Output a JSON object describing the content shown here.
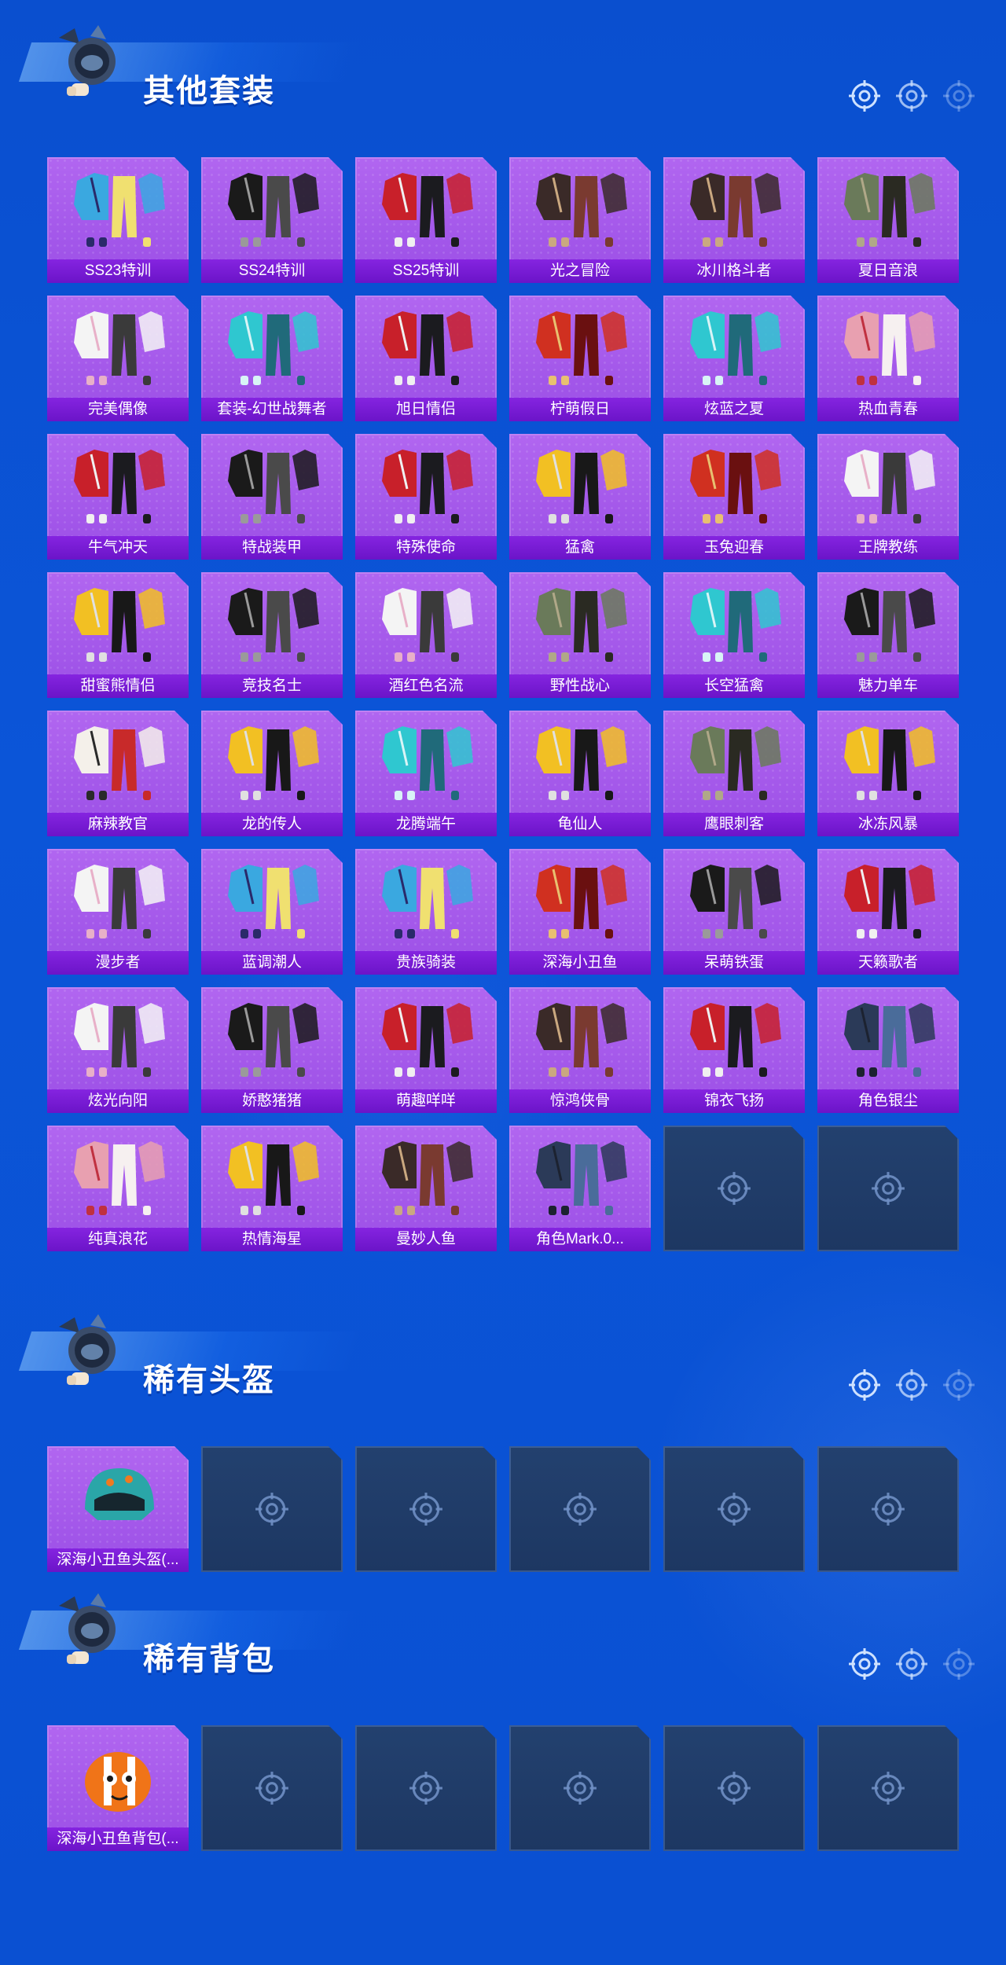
{
  "colors": {
    "background": "#0b55d8",
    "card_purple": "#a85be8",
    "label_purple": "#7a1fd8",
    "empty_slot": "#203c69"
  },
  "sections": [
    {
      "title": "其他套装",
      "items": [
        {
          "label": "SS23特训",
          "art": "suit-red-black"
        },
        {
          "label": "SS24特训",
          "art": "suit-white-red"
        },
        {
          "label": "SS25特训",
          "art": "suit-navy-jeans"
        },
        {
          "label": "光之冒险",
          "art": "suit-yellow-black"
        },
        {
          "label": "冰川格斗者",
          "art": "jacket-cyan"
        },
        {
          "label": "夏日音浪",
          "art": "summer-white"
        },
        {
          "label": "完美偶像",
          "art": "idol-cream"
        },
        {
          "label": "套装-幻世战舞者",
          "art": "dancer-blue"
        },
        {
          "label": "旭日情侣",
          "art": "hoodie-red"
        },
        {
          "label": "柠萌假日",
          "art": "dress-yellow"
        },
        {
          "label": "炫蓝之夏",
          "art": "suit-teal"
        },
        {
          "label": "热血青春",
          "art": "jacket-red-black"
        },
        {
          "label": "牛气冲天",
          "art": "suit-red-black-2"
        },
        {
          "label": "特战装甲",
          "art": "armor-black"
        },
        {
          "label": "特殊使命",
          "art": "ops-black"
        },
        {
          "label": "猛禽",
          "art": "raptor-khaki"
        },
        {
          "label": "玉兔迎春",
          "art": "rabbit-red-white"
        },
        {
          "label": "王牌教练",
          "art": "coach-orange"
        },
        {
          "label": "甜蜜熊情侣",
          "art": "bear-pink"
        },
        {
          "label": "竞技名士",
          "art": "shirt-white-blue"
        },
        {
          "label": "酒红色名流",
          "art": "suit-wine"
        },
        {
          "label": "野性战心",
          "art": "vest-orange"
        },
        {
          "label": "长空猛禽",
          "art": "camo-grey"
        },
        {
          "label": "魅力单车",
          "art": "tee-yellow"
        },
        {
          "label": "麻辣教官",
          "art": "instructor-white"
        },
        {
          "label": "龙的传人",
          "art": "dragon-red"
        },
        {
          "label": "龙腾端午",
          "art": "jacket-crimson"
        },
        {
          "label": "龟仙人",
          "art": "shirt-turtle"
        },
        {
          "label": "鹰眼刺客",
          "art": "assassin-black"
        },
        {
          "label": "冰冻风暴",
          "art": "storm-black"
        },
        {
          "label": "漫步者",
          "art": "coat-black"
        },
        {
          "label": "蓝调潮人",
          "art": "street-silver"
        },
        {
          "label": "贵族骑装",
          "art": "rider-brown"
        },
        {
          "label": "深海小丑鱼",
          "art": "clownfish-navy"
        },
        {
          "label": "呆萌铁蛋",
          "art": "robot-orange"
        },
        {
          "label": "天籁歌者",
          "art": "singer-white"
        },
        {
          "label": "炫光向阳",
          "art": "sun-cream"
        },
        {
          "label": "娇憨猪猪",
          "art": "pig-pink"
        },
        {
          "label": "萌趣咩咩",
          "art": "sheep-blue"
        },
        {
          "label": "惊鸿侠骨",
          "art": "knight-dark"
        },
        {
          "label": "锦衣飞扬",
          "art": "robe-white"
        },
        {
          "label": "角色银尘",
          "art": "silver-dust"
        },
        {
          "label": "纯真浪花",
          "art": "wave-yellow"
        },
        {
          "label": "热情海星",
          "art": "starfish-teal"
        },
        {
          "label": "曼妙人鱼",
          "art": "mermaid-blue"
        },
        {
          "label": "角色Mark.0...",
          "art": "mark-blue"
        }
      ],
      "empty_slots": 2
    },
    {
      "title": "稀有头盔",
      "items": [
        {
          "label": "深海小丑鱼头盔(...",
          "art": "helmet-teal"
        }
      ],
      "empty_slots": 5
    },
    {
      "title": "稀有背包",
      "items": [
        {
          "label": "深海小丑鱼背包(...",
          "art": "backpack-clownfish"
        }
      ],
      "empty_slots": 5
    }
  ]
}
